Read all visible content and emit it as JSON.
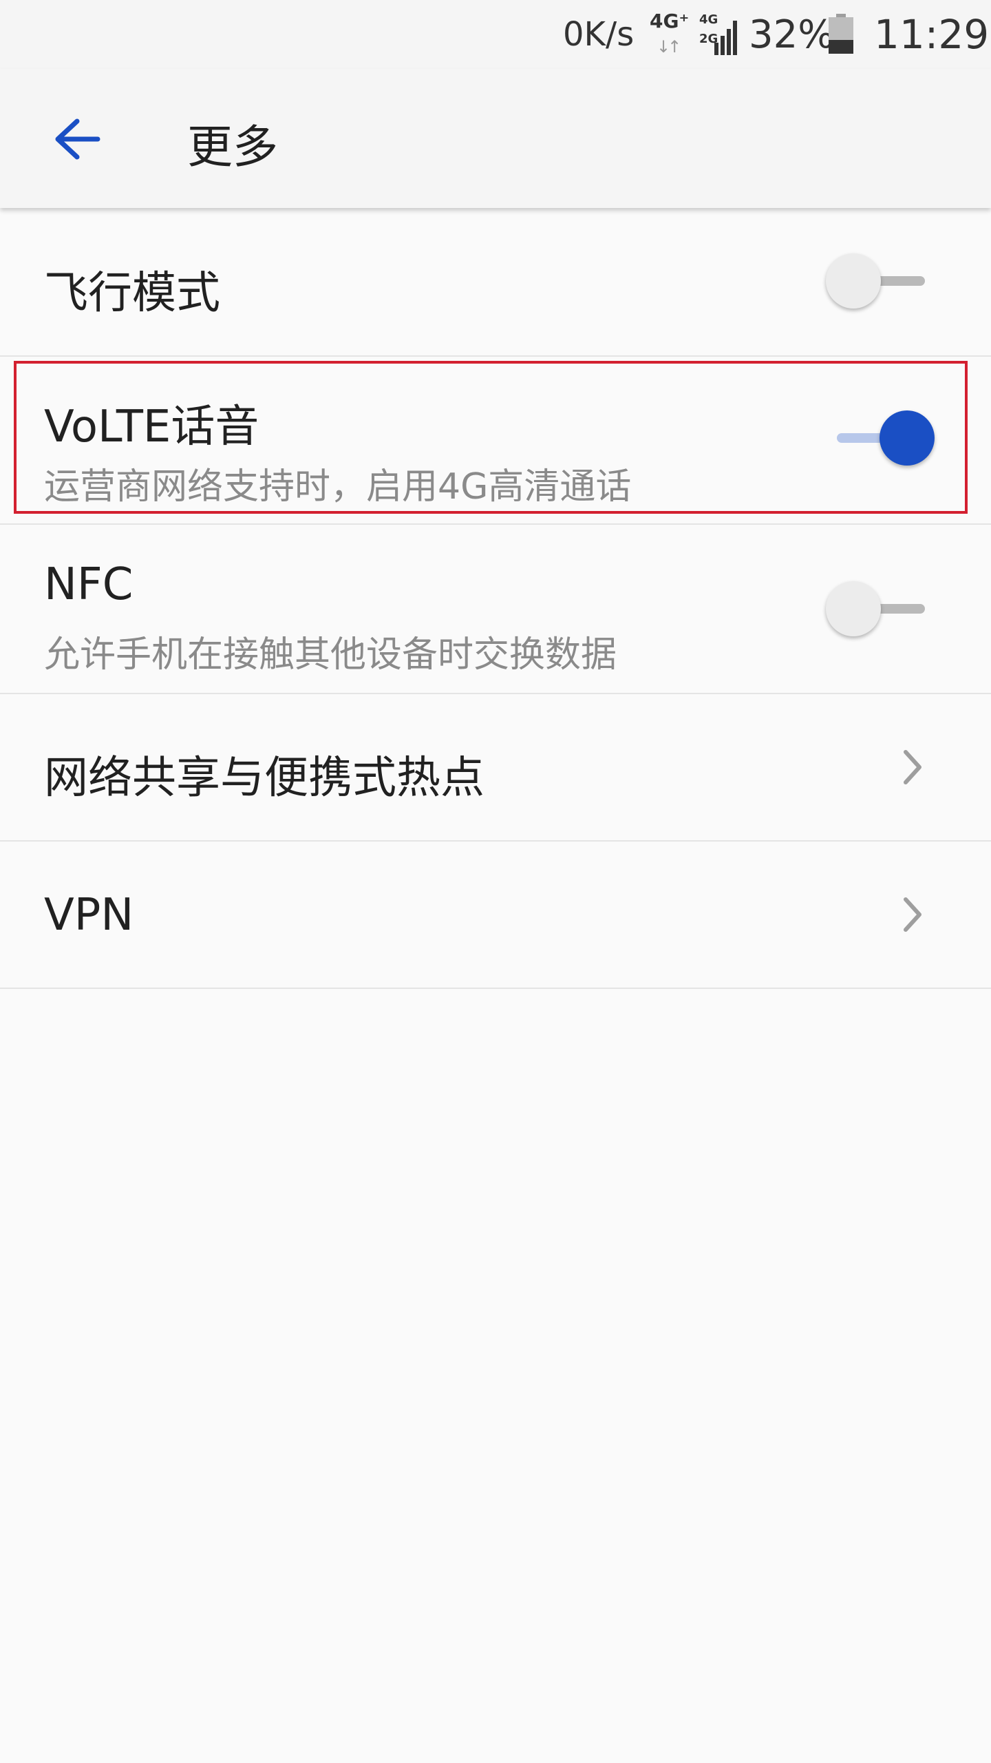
{
  "status_bar": {
    "speed": "0K/s",
    "net1_label": "4G⁺",
    "net1_arrows": "↓↑",
    "net2_label1": "4G",
    "net2_label2": "2G",
    "battery_percent": "32%",
    "time": "11:29",
    "icons": [
      "network-4g-icon",
      "signal-icon",
      "battery-icon"
    ]
  },
  "app_bar": {
    "title": "更多",
    "back_icon": "arrow-left-icon",
    "accent_color": "#1a4fc4"
  },
  "settings": {
    "airplane": {
      "title": "飞行模式",
      "enabled": false
    },
    "volte": {
      "title": "VoLTE话音",
      "summary": "运营商网络支持时，启用4G高清通话",
      "enabled": true
    },
    "nfc": {
      "title": "NFC",
      "summary": "允许手机在接触其他设备时交换数据",
      "enabled": false
    },
    "tethering": {
      "title": "网络共享与便携式热点",
      "icon": "chevron-right-icon"
    },
    "vpn": {
      "title": "VPN",
      "icon": "chevron-right-icon"
    }
  },
  "highlight_color": "#d32030"
}
